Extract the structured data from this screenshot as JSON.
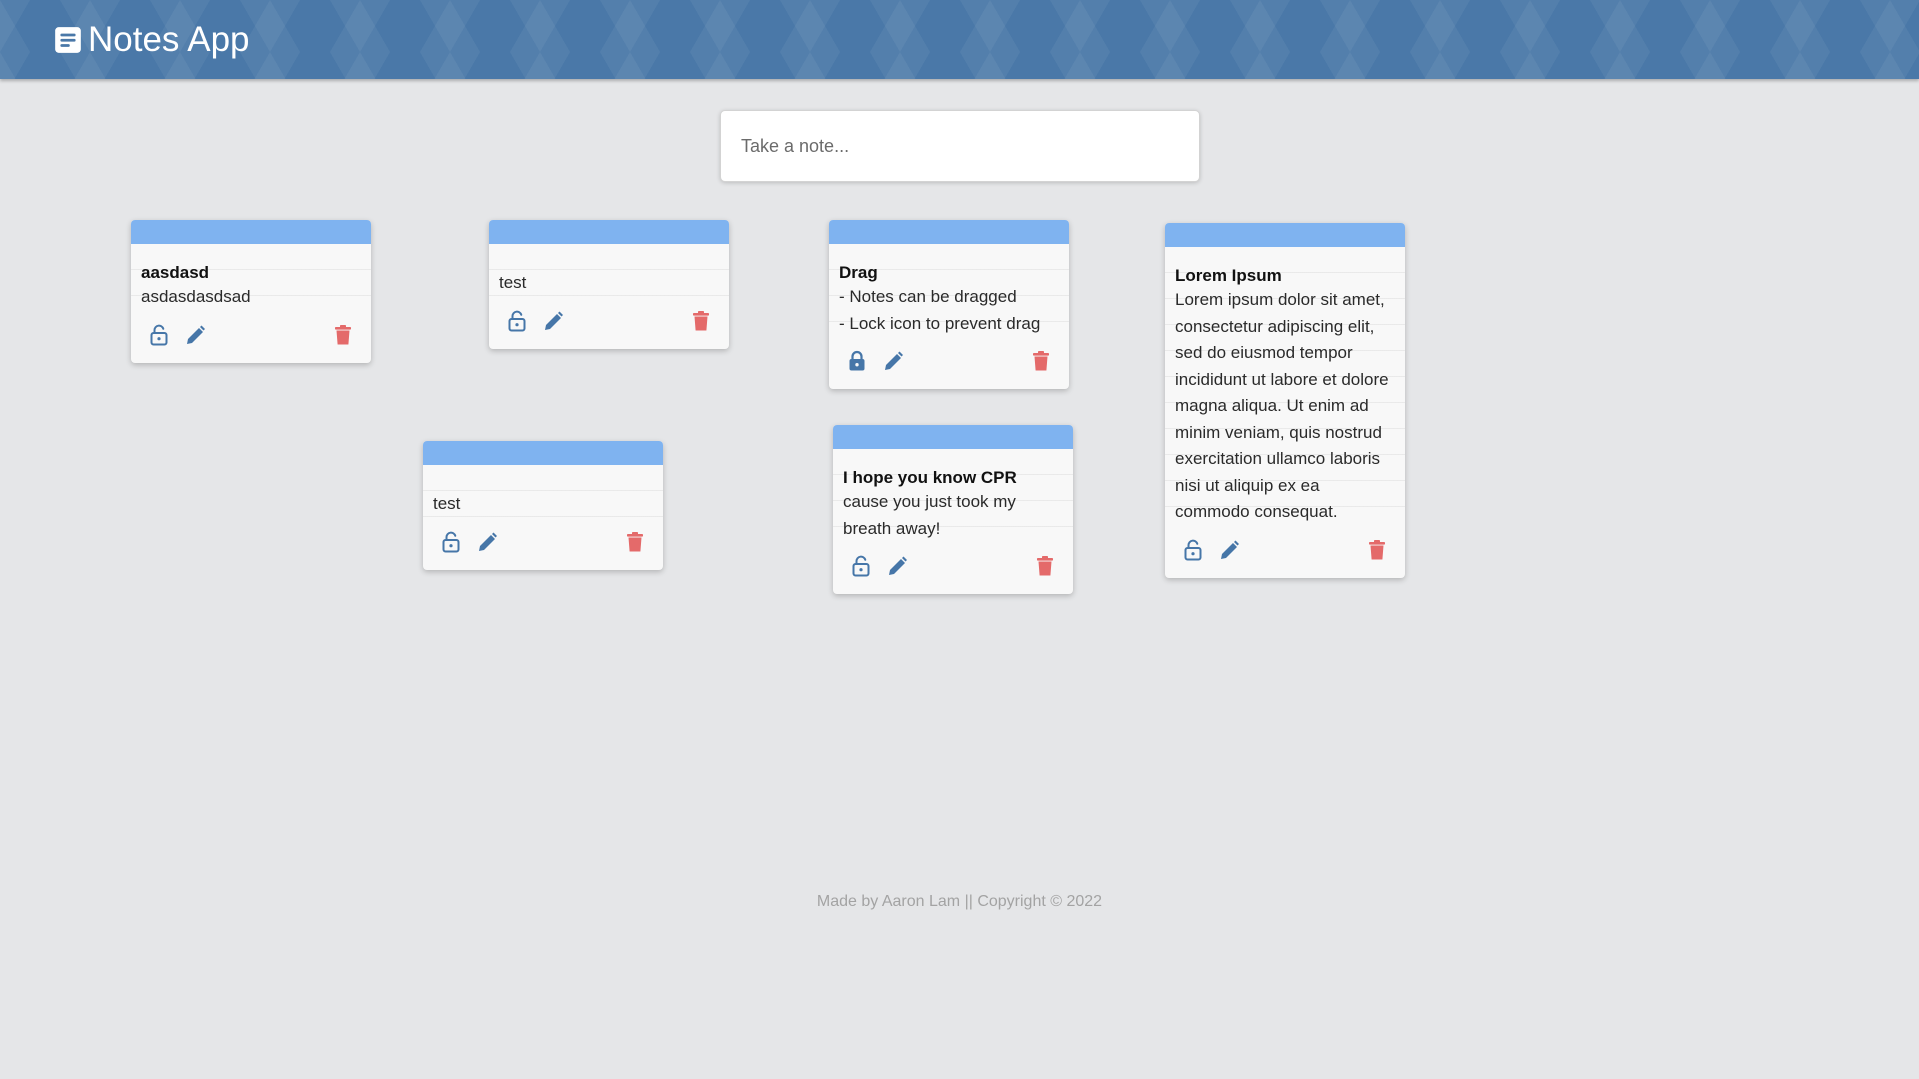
{
  "header": {
    "app_title": "Notes App",
    "icon": "notes-icon",
    "background": "#4a78a8"
  },
  "search": {
    "placeholder": "Take a note...",
    "value": ""
  },
  "notes": [
    {
      "title": "aasdasd",
      "content": "asdasdasdsad",
      "locked": false
    },
    {
      "title": "",
      "content": "test",
      "locked": false
    },
    {
      "title": "Drag",
      "content": "- Notes can be dragged\n- Lock icon to prevent drag",
      "locked": true
    },
    {
      "title": "Lorem Ipsum",
      "content": "Lorem ipsum dolor sit amet, consectetur adipiscing elit, sed do eiusmod tempor incididunt ut labore et dolore magna aliqua. Ut enim ad minim veniam, quis nostrud exercitation ullamco laboris nisi ut aliquip ex ea commodo consequat.",
      "locked": false
    },
    {
      "title": "",
      "content": "test",
      "locked": false
    },
    {
      "title": "I hope you know CPR",
      "content": "cause you just took my breath away!",
      "locked": false
    }
  ],
  "footer": {
    "text": "Made by Aaron Lam || Copyright © 2022"
  },
  "colors": {
    "note_bar": "#7fb3f0",
    "action_icon": "#4676a8",
    "delete_icon": "#e46a6a",
    "background": "#e5e6e8"
  }
}
